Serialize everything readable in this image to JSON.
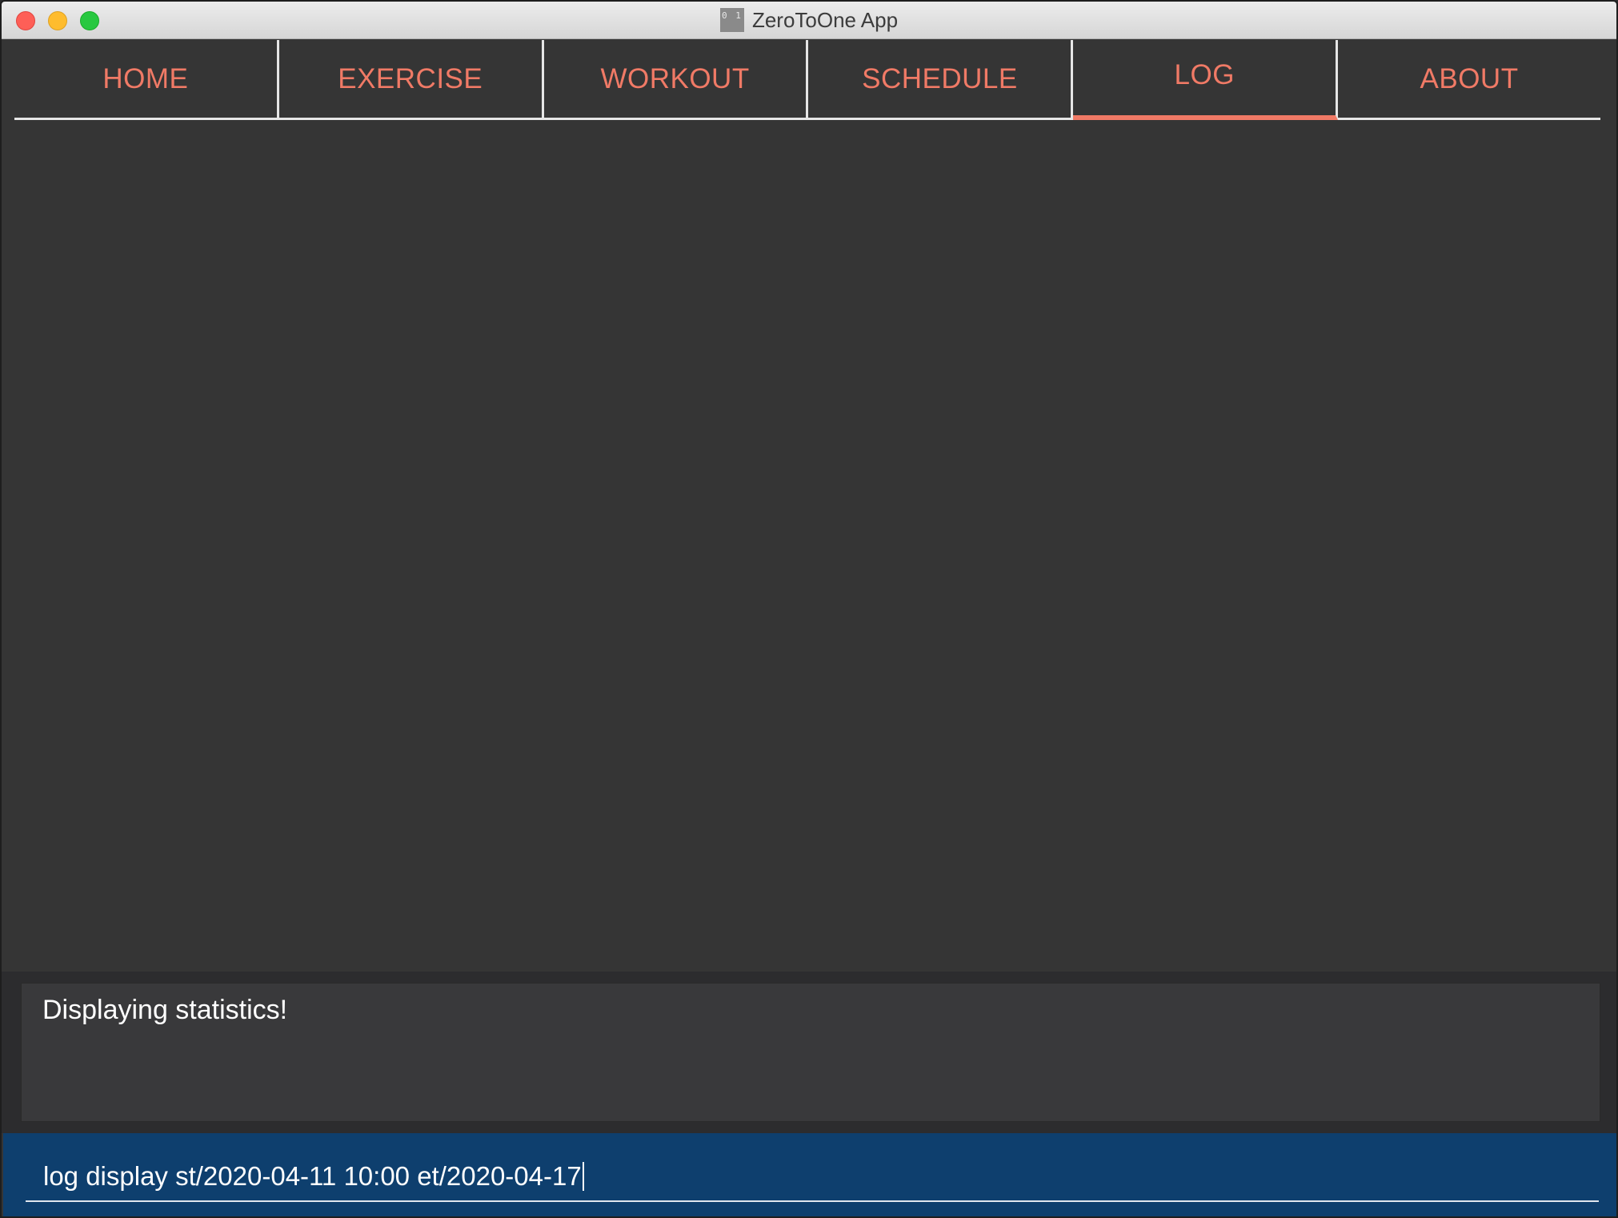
{
  "window": {
    "title": "ZeroToOne App",
    "app_icon_text": "0 1"
  },
  "tabs": [
    {
      "label": "HOME",
      "active": false
    },
    {
      "label": "EXERCISE",
      "active": false
    },
    {
      "label": "WORKOUT",
      "active": false
    },
    {
      "label": "SCHEDULE",
      "active": false
    },
    {
      "label": "LOG",
      "active": true
    },
    {
      "label": "ABOUT",
      "active": false
    }
  ],
  "result": {
    "message": "Displaying statistics!"
  },
  "command": {
    "value": "log display st/2020-04-11 10:00 et/2020-04-17"
  },
  "colors": {
    "accent": "#f07a66",
    "background": "#353535",
    "command_bar": "#0e3f6e"
  }
}
